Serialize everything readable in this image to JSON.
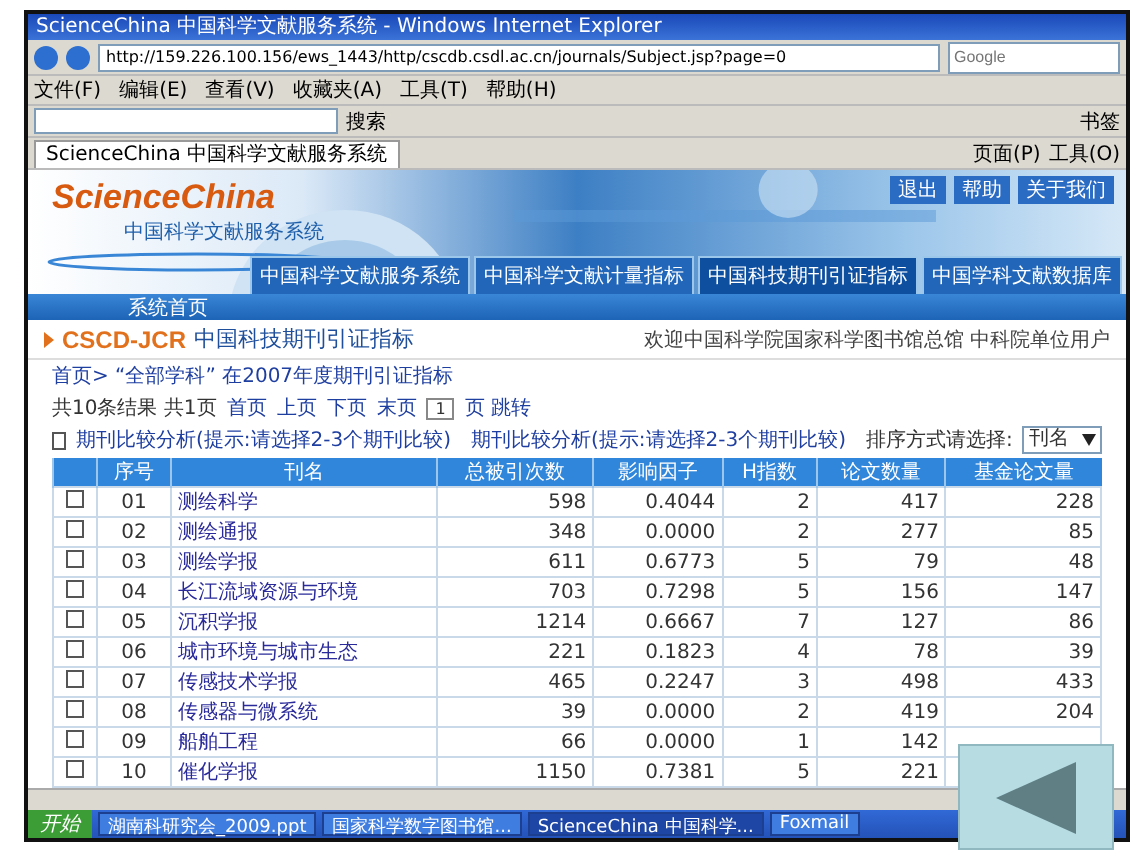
{
  "window": {
    "title": "ScienceChina 中国科学文献服务系统 - Windows Internet Explorer"
  },
  "address_bar": {
    "url": "http://159.226.100.156/ews_1443/http/cscdb.csdl.ac.cn/journals/Subject.jsp?page=0",
    "search_placeholder": "Google"
  },
  "menu": [
    "文件(F)",
    "编辑(E)",
    "查看(V)",
    "收藏夹(A)",
    "工具(T)",
    "帮助(H)"
  ],
  "google_toolbar": {
    "search_button": "搜索",
    "bookmarks": "书签"
  },
  "browser_tabs": [
    {
      "label": "ScienceChina 中国科学文献服务系统",
      "selected": true
    }
  ],
  "command_bar": [
    "页面(P)",
    "工具(O)"
  ],
  "site": {
    "logo": "ScienceChina",
    "logo_subtitle": "中国科学文献服务系统",
    "top_buttons": [
      "退出",
      "帮助",
      "关于我们"
    ],
    "nav_tabs": [
      {
        "label": "中国科学文献服务系统",
        "selected": false
      },
      {
        "label": "中国科学文献计量指标",
        "selected": false
      },
      {
        "label": "中国科技期刊引证指标",
        "selected": true
      },
      {
        "label": "中国学科文献数据库",
        "selected": false
      }
    ],
    "nav_link": "系统首页",
    "heading_code": "CSCD-JCR",
    "heading": "中国科技期刊引证指标",
    "welcome": "欢迎中国科学院国家科学图书馆总馆 中科院单位用户",
    "breadcrumb": "首页> “全部学科” 在2007年度期刊引证指标",
    "pager": {
      "summary": "共10条结果 共1页",
      "links": [
        "首页",
        "上页",
        "下页",
        "末页"
      ],
      "page": "1",
      "go": "页 跳转"
    },
    "compare_checked": false,
    "compare_left": "期刊比较分析(提示:请选择2-3个期刊比较)",
    "compare_center": "期刊比较分析(提示:请选择2-3个期刊比较)",
    "sort_label": "排序方式请选择:",
    "sort_value": "刊名"
  },
  "table": {
    "columns": [
      "序号",
      "刊名",
      "总被引次数",
      "影响因子",
      "H指数",
      "论文数量",
      "基金论文量"
    ],
    "rows": [
      {
        "checked": false,
        "cells": [
          "01",
          "测绘科学",
          "598",
          "0.4044",
          "2",
          "417",
          "228"
        ]
      },
      {
        "checked": false,
        "cells": [
          "02",
          "测绘通报",
          "348",
          "0.0000",
          "2",
          "277",
          "85"
        ]
      },
      {
        "checked": false,
        "cells": [
          "03",
          "测绘学报",
          "611",
          "0.6773",
          "5",
          "79",
          "48"
        ]
      },
      {
        "checked": false,
        "cells": [
          "04",
          "长江流域资源与环境",
          "703",
          "0.7298",
          "5",
          "156",
          "147"
        ]
      },
      {
        "checked": false,
        "cells": [
          "05",
          "沉积学报",
          "1214",
          "0.6667",
          "7",
          "127",
          "86"
        ]
      },
      {
        "checked": false,
        "cells": [
          "06",
          "城市环境与城市生态",
          "221",
          "0.1823",
          "4",
          "78",
          "39"
        ]
      },
      {
        "checked": false,
        "cells": [
          "07",
          "传感技术学报",
          "465",
          "0.2247",
          "3",
          "498",
          "433"
        ]
      },
      {
        "checked": false,
        "cells": [
          "08",
          "传感器与微系统",
          "39",
          "0.0000",
          "2",
          "419",
          "204"
        ]
      },
      {
        "checked": false,
        "cells": [
          "09",
          "船舶工程",
          "66",
          "0.0000",
          "1",
          "142"
        ]
      },
      {
        "checked": false,
        "cells": [
          "10",
          "催化学报",
          "1150",
          "0.7381",
          "5",
          "221"
        ]
      }
    ]
  },
  "taskbar": {
    "start": "开始",
    "tasks": [
      {
        "label": "湖南科研究会_2009.ppt",
        "selected": false
      },
      {
        "label": "国家科学数字图书馆...",
        "selected": false
      },
      {
        "label": "ScienceChina 中国科学...",
        "selected": true
      },
      {
        "label": "Foxmail",
        "selected": false
      }
    ]
  }
}
